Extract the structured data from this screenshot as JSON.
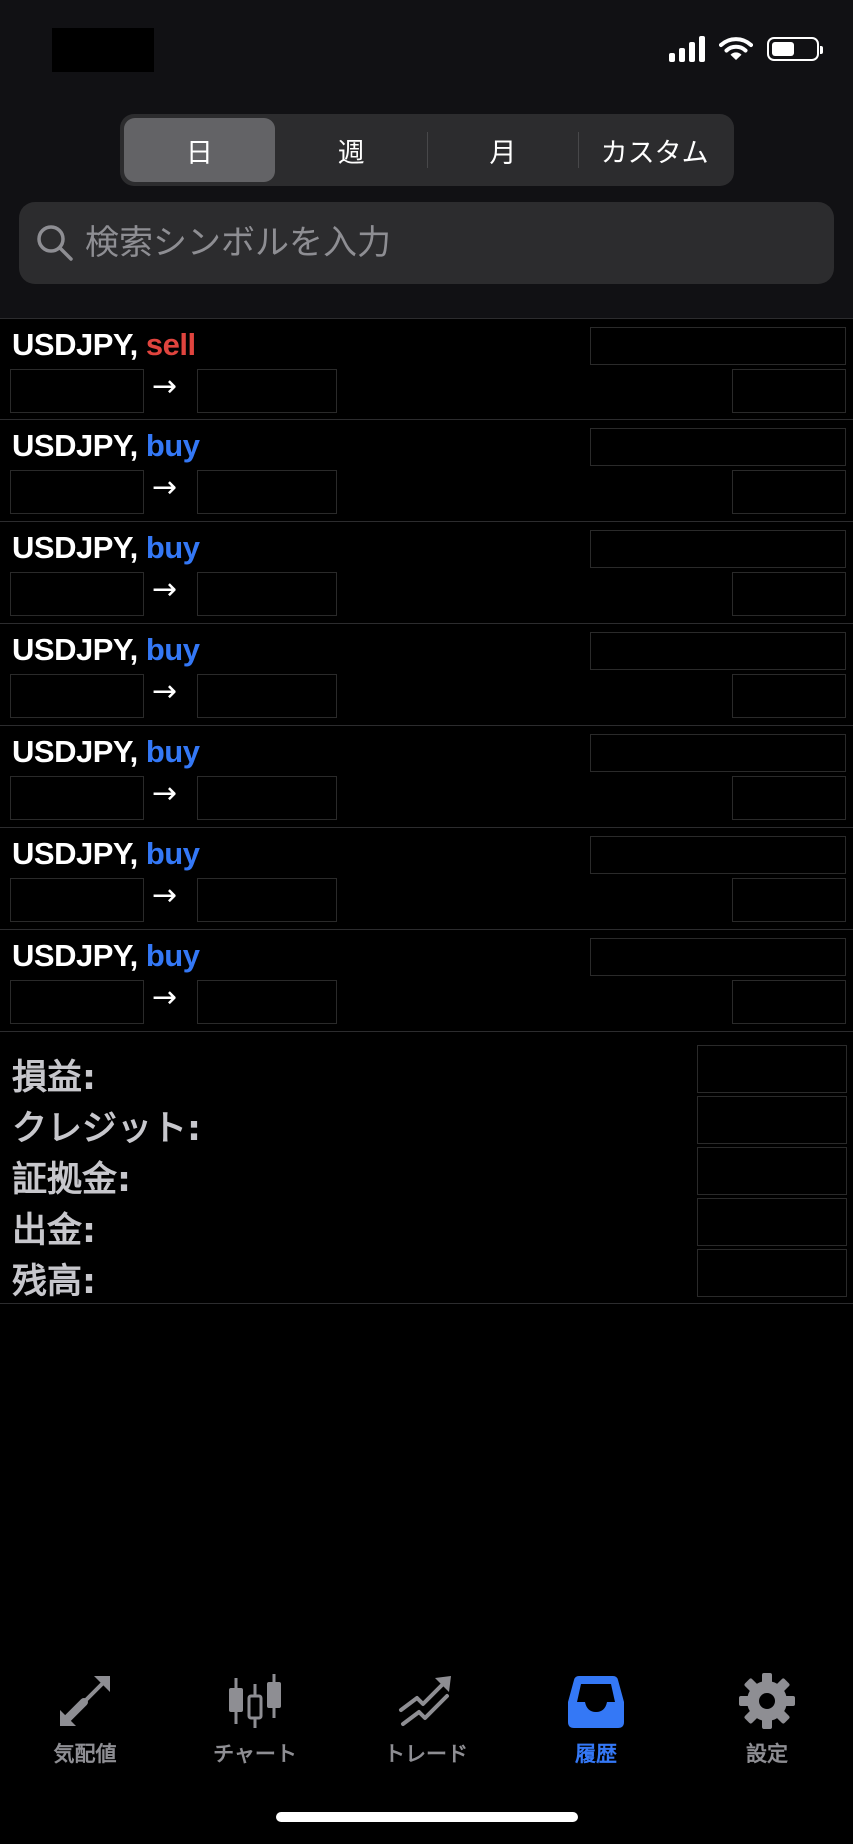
{
  "segments": [
    "日",
    "週",
    "月",
    "カスタム"
  ],
  "search": {
    "placeholder": "検索シンボルを入力"
  },
  "deals": [
    {
      "symbol": "USDJPY,",
      "side": "sell"
    },
    {
      "symbol": "USDJPY,",
      "side": "buy"
    },
    {
      "symbol": "USDJPY,",
      "side": "buy"
    },
    {
      "symbol": "USDJPY,",
      "side": "buy"
    },
    {
      "symbol": "USDJPY,",
      "side": "buy"
    },
    {
      "symbol": "USDJPY,",
      "side": "buy"
    },
    {
      "symbol": "USDJPY,",
      "side": "buy"
    }
  ],
  "arrow": "→",
  "summary": [
    "損益:",
    "クレジット:",
    "証拠金:",
    "出金:",
    "残高:"
  ],
  "tabs": [
    {
      "label": "気配値",
      "icon": "quotes-arrows-icon"
    },
    {
      "label": "チャート",
      "icon": "candlestick-chart-icon"
    },
    {
      "label": "トレード",
      "icon": "trade-trend-icon"
    },
    {
      "label": "履歴",
      "icon": "inbox-tray-icon"
    },
    {
      "label": "設定",
      "icon": "gear-icon"
    }
  ],
  "colors": {
    "sell": "#e0443e",
    "buy": "#3478f6",
    "active_tab": "#3478f6",
    "inactive_tab": "#8e8e93"
  }
}
